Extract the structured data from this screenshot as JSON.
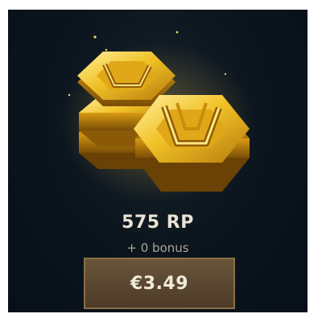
{
  "bundle": {
    "amount_label": "575 RP",
    "bonus_label": "+ 0 bonus",
    "price_label": "€3.49",
    "image_icon": "riot-points-coins-icon"
  },
  "colors": {
    "background": "#0b141c",
    "gold": "#e8b81c",
    "button_fill": "#5c4731",
    "button_border": "#8a6e48",
    "text_primary": "#e9e4d3",
    "text_secondary": "#a9a697"
  }
}
